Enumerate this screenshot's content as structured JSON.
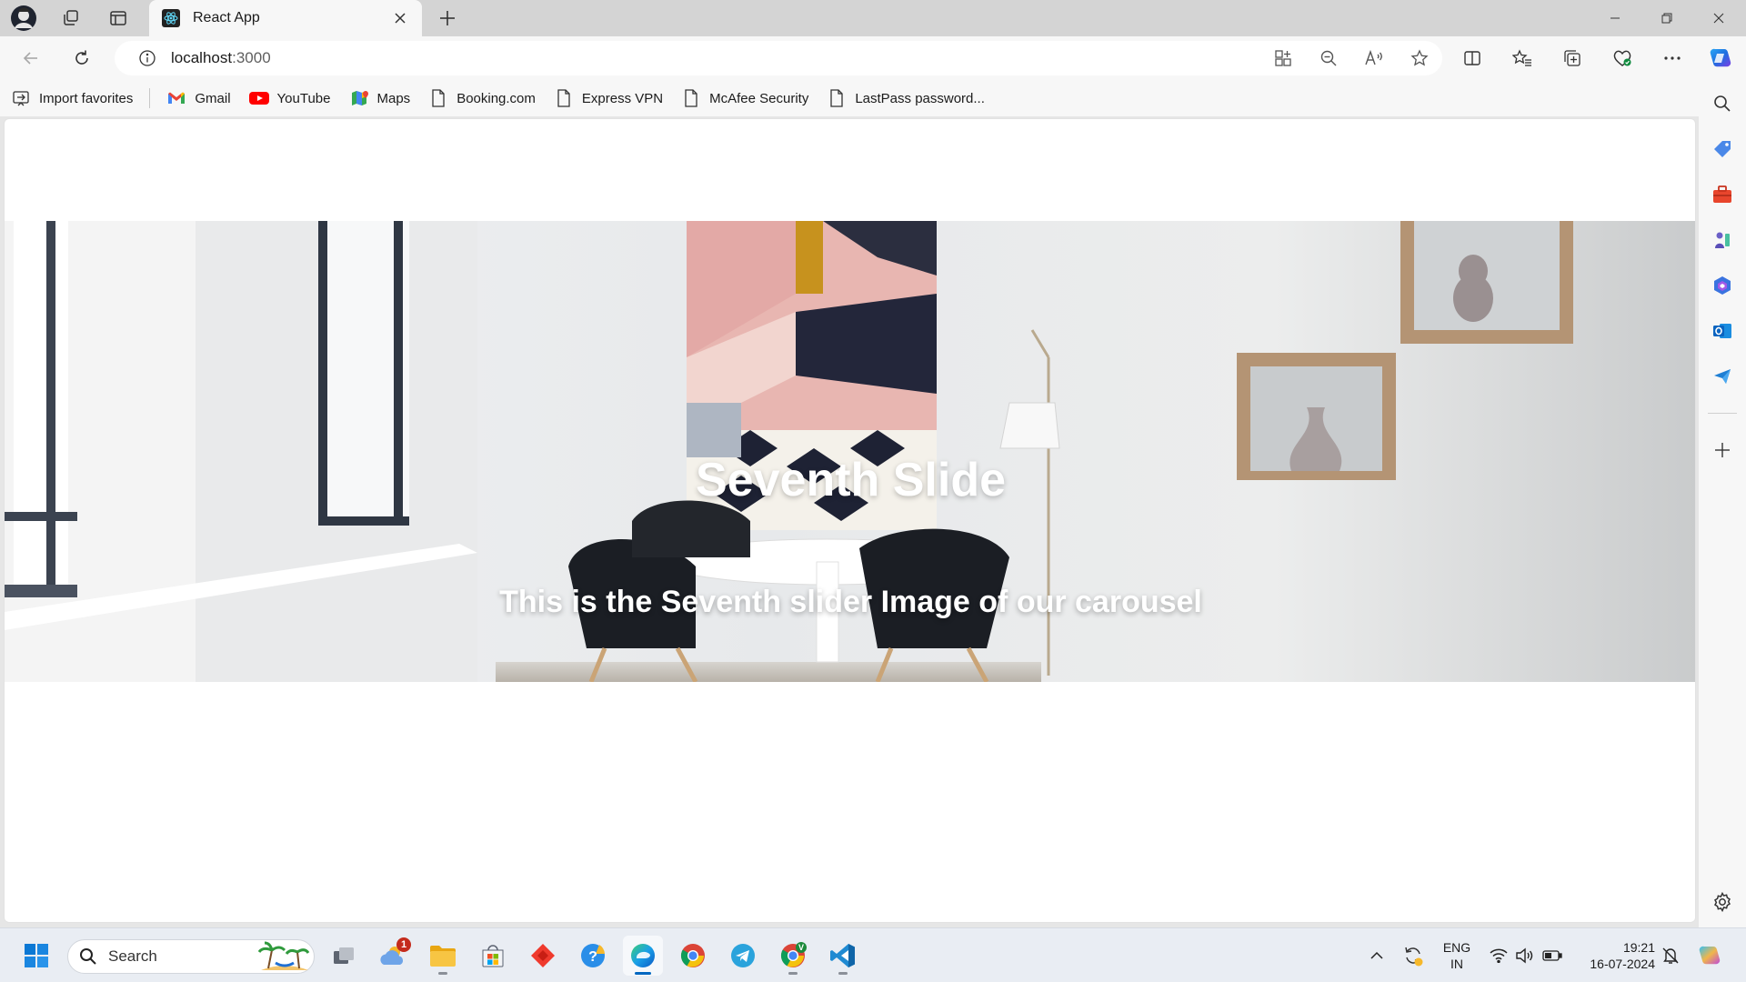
{
  "browser": {
    "tab_title": "React App",
    "address_host": "localhost",
    "address_port": ":3000"
  },
  "favorites": [
    {
      "label": "Import favorites",
      "icon": "import-icon"
    },
    {
      "label": "Gmail",
      "icon": "gmail-icon"
    },
    {
      "label": "YouTube",
      "icon": "youtube-icon"
    },
    {
      "label": "Maps",
      "icon": "maps-icon"
    },
    {
      "label": "Booking.com",
      "icon": "page-icon"
    },
    {
      "label": "Express VPN",
      "icon": "page-icon"
    },
    {
      "label": "McAfee Security",
      "icon": "page-icon"
    },
    {
      "label": "LastPass password...",
      "icon": "page-icon"
    }
  ],
  "carousel": {
    "title": "Seventh Slide",
    "caption": "This is the Seventh slider Image of our carousel"
  },
  "taskbar": {
    "search_label": "Search",
    "weather_badge": "1",
    "chrome_badge": "V",
    "lang_line1": "ENG",
    "lang_line2": "IN",
    "time": "19:21",
    "date": "16-07-2024"
  },
  "colors": {
    "accent": "#0067c0",
    "tabstrip": "#d4d4d4",
    "toolbar": "#f7f7f7"
  }
}
